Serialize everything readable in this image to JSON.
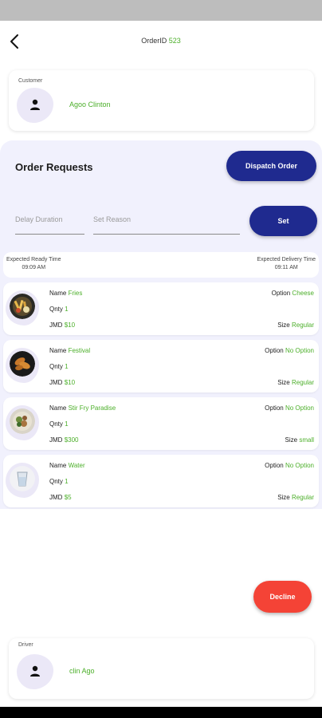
{
  "header": {
    "order_label": "OrderID",
    "order_id": "523"
  },
  "customer": {
    "label": "Customer",
    "name": "Agoo Clinton"
  },
  "requests": {
    "title": "Order Requests",
    "dispatch_label": "Dispatch Order",
    "delay_placeholder": "Delay Duration",
    "reason_placeholder": "Set Reason",
    "set_label": "Set",
    "ready_label": "Expected Ready Time",
    "ready_time": "09:09 AM",
    "delivery_label": "Expected Delivery Time",
    "delivery_time": "09:11 AM"
  },
  "items": [
    {
      "name_label": "Name",
      "name": "Fries",
      "qty_label": "Qnty",
      "qty": "1",
      "price_label": "JMD",
      "price": "$10",
      "option_label": "Option",
      "option": "Cheese",
      "size_label": "Size",
      "size": "Regular",
      "image": "fries"
    },
    {
      "name_label": "Name",
      "name": "Festival",
      "qty_label": "Qnty",
      "qty": "1",
      "price_label": "JMD",
      "price": "$10",
      "option_label": "Option",
      "option": "No Option",
      "size_label": "Size",
      "size": "Regular",
      "image": "festival"
    },
    {
      "name_label": "Name",
      "name": "Stir Fry Paradise",
      "qty_label": "Qnty",
      "qty": "1",
      "price_label": "JMD",
      "price": "$300",
      "option_label": "Option",
      "option": "No Option",
      "size_label": "Size",
      "size": "small",
      "image": "stir-fry"
    },
    {
      "name_label": "Name",
      "name": "Water",
      "qty_label": "Qnty",
      "qty": "1",
      "price_label": "JMD",
      "price": "$5",
      "option_label": "Option",
      "option": "No Option",
      "size_label": "Size",
      "size": "Regular",
      "image": "water"
    }
  ],
  "decline_label": "Decline",
  "driver": {
    "label": "Driver",
    "name": "clin Ago"
  },
  "colors": {
    "accent_blue": "#1f2a8f",
    "green": "#4caf2a",
    "red": "#f44336",
    "panel": "#f1f1fd"
  },
  "icons": {
    "back": "back-arrow-icon",
    "person": "person-icon"
  }
}
